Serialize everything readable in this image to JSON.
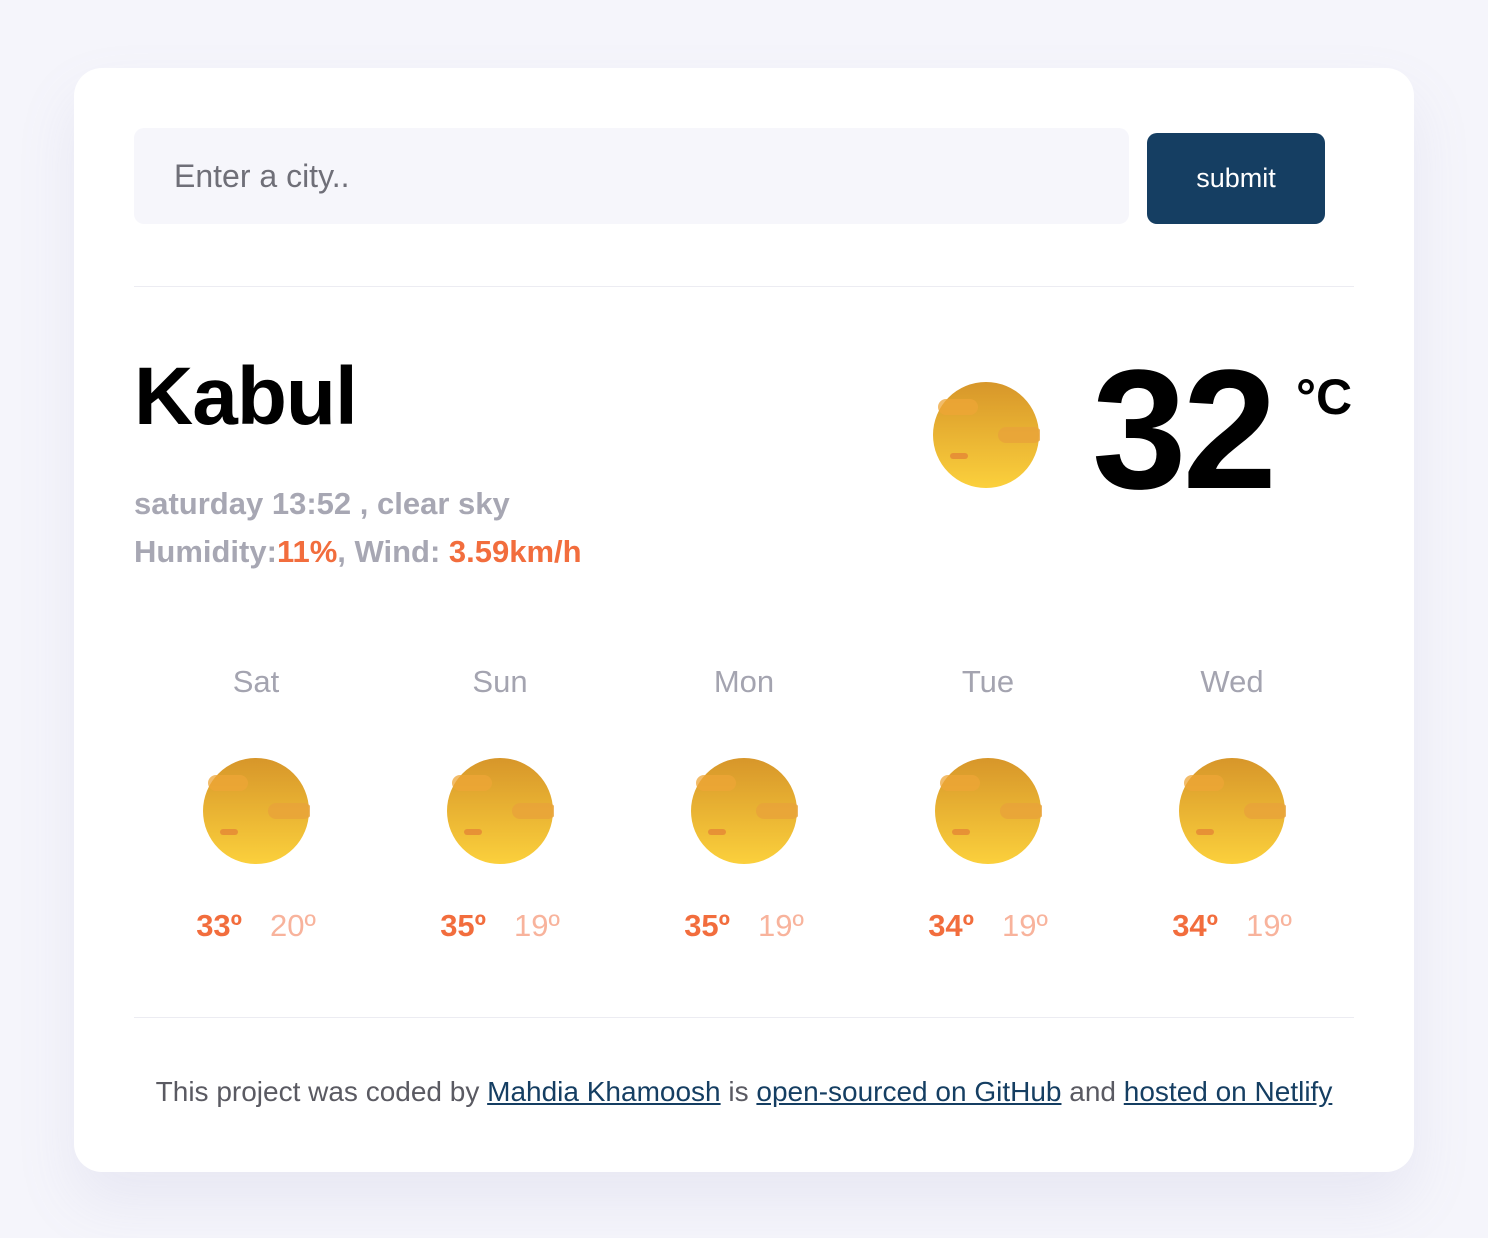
{
  "search": {
    "placeholder": "Enter a city..",
    "submit_label": "submit"
  },
  "current": {
    "city": "Kabul",
    "day": "saturday",
    "time": "13:52",
    "description": "clear sky",
    "humidity_label": "Humidity:",
    "humidity_value": "11%",
    "wind_label": ", Wind: ",
    "wind_value": "3.59km/h",
    "temperature": "32",
    "unit": "°C",
    "icon": "clear-sky-sun-icon"
  },
  "forecast": [
    {
      "day": "Sat",
      "max": "33º",
      "min": "20º",
      "icon": "clear-sky-sun-icon"
    },
    {
      "day": "Sun",
      "max": "35º",
      "min": "19º",
      "icon": "clear-sky-sun-icon"
    },
    {
      "day": "Mon",
      "max": "35º",
      "min": "19º",
      "icon": "clear-sky-sun-icon"
    },
    {
      "day": "Tue",
      "max": "34º",
      "min": "19º",
      "icon": "clear-sky-sun-icon"
    },
    {
      "day": "Wed",
      "max": "34º",
      "min": "19º",
      "icon": "clear-sky-sun-icon"
    }
  ],
  "footer": {
    "prefix": "This project was coded by ",
    "author_link": "Mahdia Khamoosh",
    "middle1": " is ",
    "github_link": "open-sourced on GitHub",
    "middle2": " and ",
    "netlify_link": "hosted on Netlify"
  },
  "colors": {
    "accent": "#f26d3d",
    "accent_light": "#f8b39c",
    "button": "#153e62",
    "muted_text": "#a7a7b3",
    "background": "#f5f5fb"
  }
}
